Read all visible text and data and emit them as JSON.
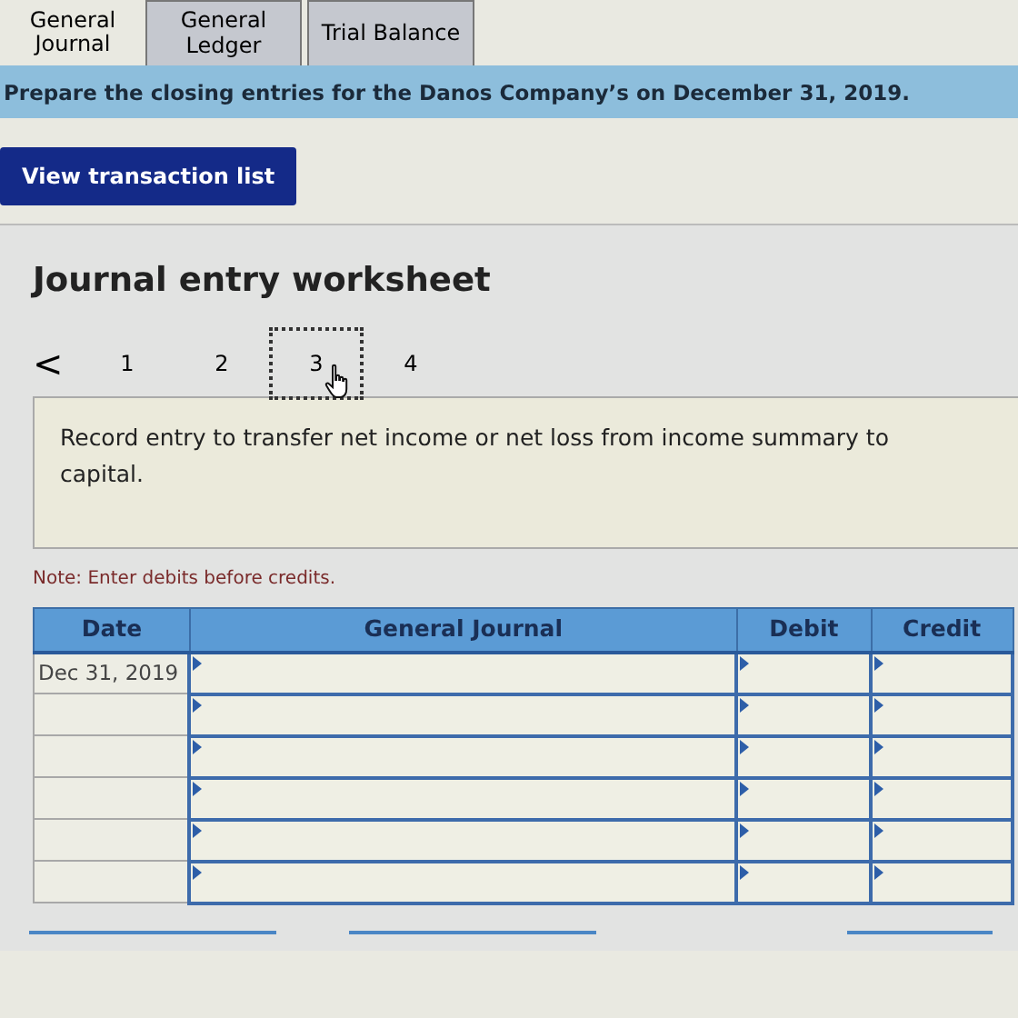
{
  "tabs": [
    {
      "label": "General Journal",
      "selected": true
    },
    {
      "label": "General Ledger",
      "selected": false
    },
    {
      "label": "Trial Balance",
      "selected": false
    }
  ],
  "banner": "Prepare the closing entries for the Danos Company’s on December 31, 2019.",
  "view_button": "View transaction list",
  "worksheet": {
    "title": "Journal entry worksheet",
    "prev": "<",
    "pages": [
      {
        "label": "1",
        "selected": false
      },
      {
        "label": "2",
        "selected": false
      },
      {
        "label": "3",
        "selected": true
      },
      {
        "label": "4",
        "selected": false
      }
    ],
    "instruction": "Record entry to transfer net income or net loss from income summary to capital.",
    "note": "Note: Enter debits before credits."
  },
  "table": {
    "columns": [
      "Date",
      "General Journal",
      "Debit",
      "Credit"
    ],
    "rows": [
      {
        "kind": "dated",
        "date": "Dec 31, 2019"
      },
      {
        "kind": "blank"
      },
      {
        "kind": "blank"
      },
      {
        "kind": "blank"
      },
      {
        "kind": "blank"
      },
      {
        "kind": "blank"
      }
    ]
  }
}
